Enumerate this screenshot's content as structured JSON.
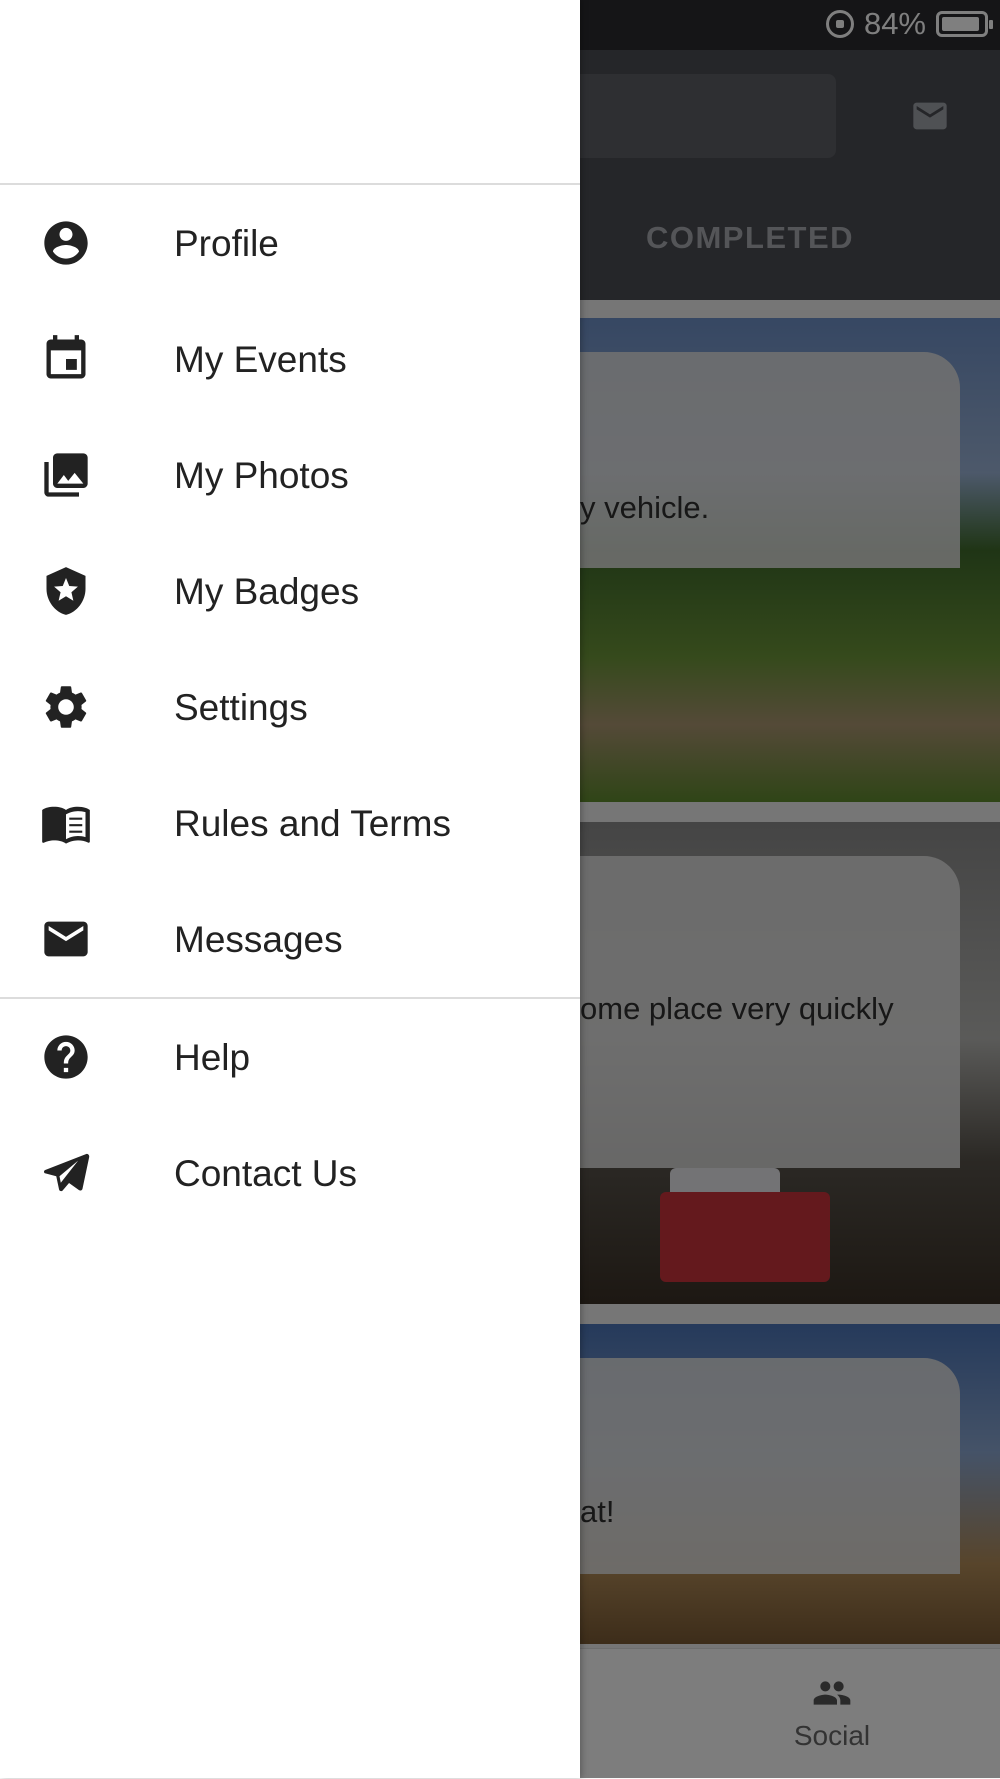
{
  "status_bar": {
    "battery_percent": "84%"
  },
  "background": {
    "tab_completed": "COMPLETED",
    "cards": [
      {
        "text": "y vehicle."
      },
      {
        "text": "ome place very quickly"
      },
      {
        "text": "at!"
      }
    ],
    "bottom_nav": {
      "social_label": "Social"
    }
  },
  "drawer": {
    "primary_items": [
      {
        "label": "Profile",
        "icon": "account-circle-icon"
      },
      {
        "label": "My Events",
        "icon": "calendar-event-icon"
      },
      {
        "label": "My Photos",
        "icon": "photo-library-icon"
      },
      {
        "label": "My Badges",
        "icon": "shield-star-icon"
      },
      {
        "label": "Settings",
        "icon": "gear-icon"
      },
      {
        "label": "Rules and Terms",
        "icon": "book-open-icon"
      },
      {
        "label": "Messages",
        "icon": "mail-icon"
      }
    ],
    "secondary_items": [
      {
        "label": "Help",
        "icon": "help-circle-icon"
      },
      {
        "label": "Contact Us",
        "icon": "send-icon"
      }
    ]
  },
  "colors": {
    "drawer_bg": "#ffffff",
    "text": "#222222",
    "scrim": "rgba(0,0,0,0.5)",
    "topbar": "#4a4c52"
  }
}
